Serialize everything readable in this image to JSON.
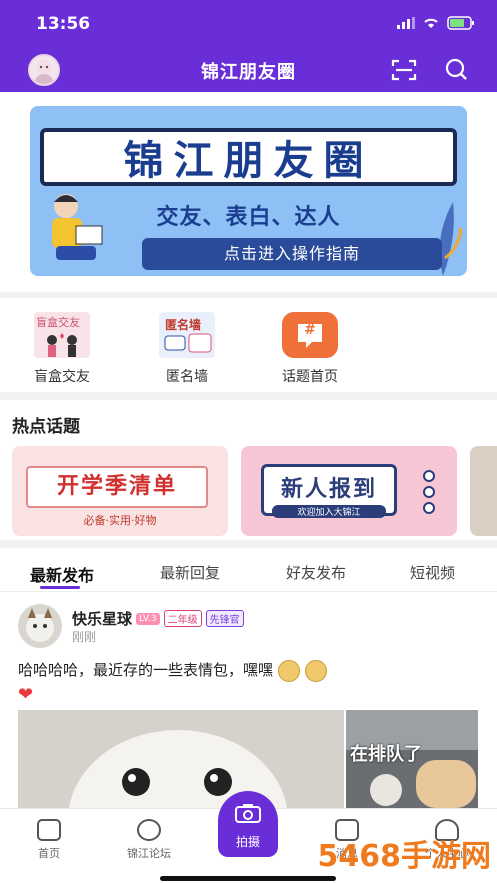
{
  "status": {
    "time": "13:56"
  },
  "header": {
    "title": "锦江朋友圈"
  },
  "banner": {
    "title": "锦江朋友圈",
    "subtitle": "交友、表白、达人",
    "button": "点击进入操作指南"
  },
  "quick": [
    {
      "label": "盲盒交友",
      "img_text": "盲盒交友",
      "color": "#f8e3e8"
    },
    {
      "label": "匿名墙",
      "img_text": "匿名墙",
      "color": "#e9f0fb"
    },
    {
      "label": "话题首页",
      "img_text": "#",
      "color": "#f0703a"
    }
  ],
  "hot": {
    "title": "热点话题",
    "cards": [
      {
        "title": "开学季清单",
        "sub": "必备·实用·好物"
      },
      {
        "title": "新人报到",
        "sub": "欢迎加入大锦江"
      }
    ]
  },
  "feed": {
    "tabs": [
      "最新发布",
      "最新回复",
      "好友发布",
      "短视频"
    ],
    "post": {
      "name": "快乐星球",
      "level": "LV.3",
      "grade": "二年级",
      "role": "先锋官",
      "time": "刚刚",
      "text": "哈哈哈哈，最近存的一些表情包，嘿嘿",
      "image_text": "在排队了"
    }
  },
  "nav": {
    "items": [
      "首页",
      "锦江论坛",
      "拍摄",
      "消息",
      "个人中心"
    ]
  },
  "watermark": "5468手游网",
  "colors": {
    "primary": "#6a2ed8",
    "accent": "#f0703a"
  }
}
